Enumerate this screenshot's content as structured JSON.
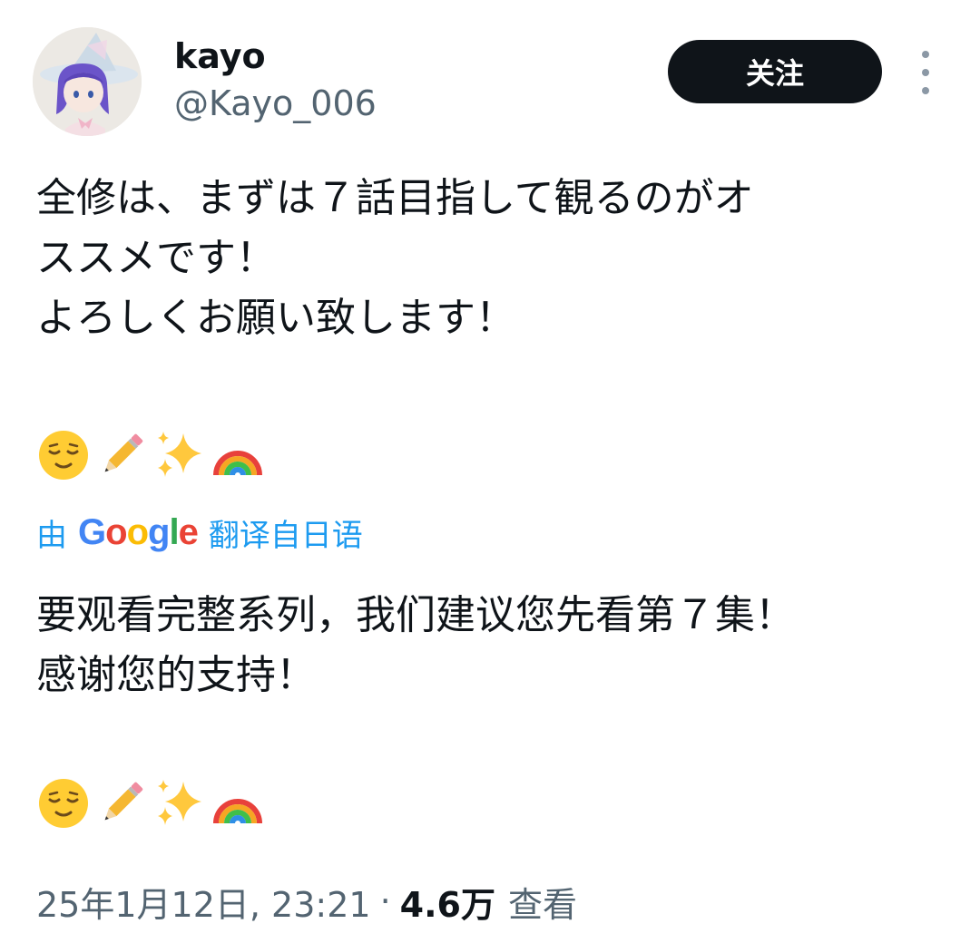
{
  "author": {
    "display_name": "kayo",
    "handle": "@Kayo_006"
  },
  "follow_button_label": "关注",
  "more_icon": "more-vertical-icon",
  "tweet": {
    "text": "全修は、まずは７話目指して観るのがオ\nススメです！\nよろしくお願い致します！",
    "emojis": [
      "relieved-face",
      "pencil",
      "sparkles",
      "rainbow"
    ]
  },
  "translation": {
    "prefix": "由",
    "provider": "Google",
    "suffix": "翻译自日语",
    "text": "要观看完整系列，我们建议您先看第７集！\n感谢您的支持！",
    "emojis": [
      "relieved-face",
      "pencil",
      "sparkles",
      "rainbow"
    ]
  },
  "meta": {
    "timestamp": "25年1月12日, 23:21",
    "separator": "·",
    "views_count": "4.6万",
    "views_label": "查看"
  },
  "colors": {
    "link_blue": "#1d9bf0",
    "secondary_text": "#536471",
    "primary_text": "#0f1419"
  }
}
